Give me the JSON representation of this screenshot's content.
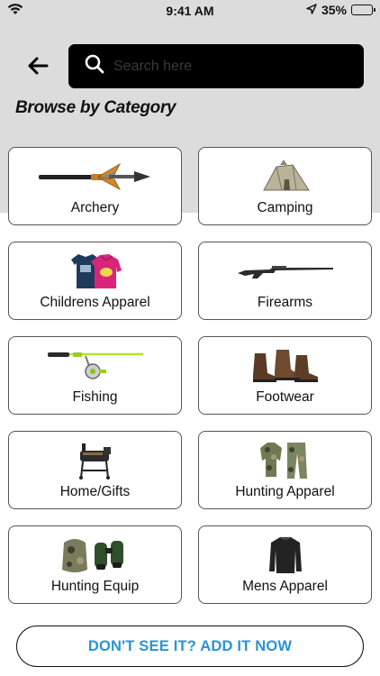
{
  "status_bar": {
    "time": "9:41 AM",
    "battery": "35%",
    "battery_level": 0.35,
    "icons": [
      "wifi-icon",
      "location-arrow-icon",
      "battery-icon"
    ]
  },
  "header": {
    "back_icon": "arrow-left-icon",
    "search": {
      "placeholder": "Search here",
      "value": "",
      "icon": "search-icon"
    }
  },
  "section_title": "Browse by Category",
  "categories": [
    {
      "label": "Archery",
      "icon": "arrow-broadhead-icon"
    },
    {
      "label": "Camping",
      "icon": "tent-icon"
    },
    {
      "label": "Childrens Apparel",
      "icon": "kids-tshirt-hoodie-icon"
    },
    {
      "label": "Firearms",
      "icon": "rifle-icon"
    },
    {
      "label": "Fishing",
      "icon": "fishing-rod-reel-icon"
    },
    {
      "label": "Footwear",
      "icon": "boots-icon"
    },
    {
      "label": "Home/Gifts",
      "icon": "smoker-grill-icon"
    },
    {
      "label": "Hunting Apparel",
      "icon": "camo-outfit-icon"
    },
    {
      "label": "Hunting Equip",
      "icon": "backpack-binoculars-icon"
    },
    {
      "label": "Mens Apparel",
      "icon": "long-sleeve-shirt-icon"
    }
  ],
  "cta_label": "DON'T SEE IT? ADD IT NOW",
  "colors": {
    "header_background": "#dcdcdc",
    "search_background": "#000000",
    "cta_text": "#2a93d5",
    "battery_fill": "#4cd964"
  }
}
